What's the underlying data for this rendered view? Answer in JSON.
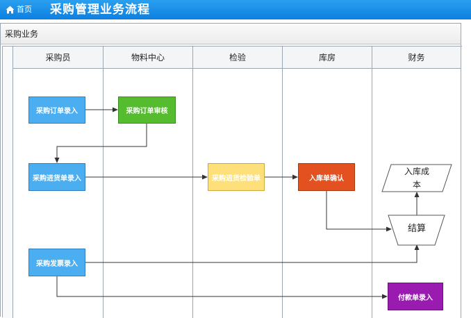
{
  "topbar": {
    "home_label": "首页",
    "title": "采购管理业务流程",
    "bg_color": "#1a8ce6"
  },
  "panel": {
    "title": "采购业务"
  },
  "lanes": [
    {
      "label": "采购员"
    },
    {
      "label": "物料中心"
    },
    {
      "label": "检验"
    },
    {
      "label": "库房"
    },
    {
      "label": "财务"
    }
  ],
  "nodes": {
    "order_entry": "采购订单录入",
    "order_review": "采购订单审核",
    "receipt_entry": "采购进货单录入",
    "inspection": "采购进货检验单",
    "warehouse_confirm": "入库单确认",
    "invoice_entry": "采购发票录入",
    "payment_entry": "付款单录入",
    "inbound_cost_line1": "入库成",
    "inbound_cost_line2": "本",
    "settlement": "结算"
  },
  "colors": {
    "blue": "#4aaef0",
    "green": "#55bb2f",
    "yellow": "#fde07a",
    "orange": "#e2511f",
    "purple": "#9a1bb0"
  }
}
